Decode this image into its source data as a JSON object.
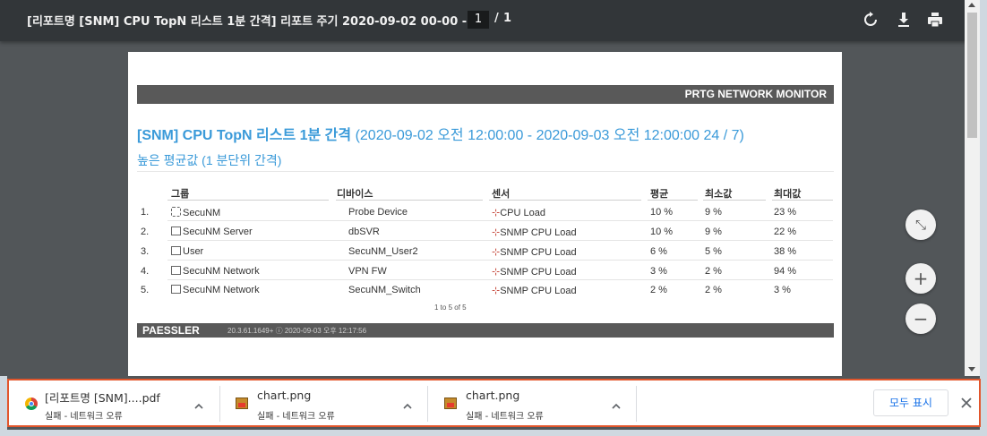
{
  "toolbar": {
    "title": "[리포트명 [SNM] CPU TopN 리스트 1분 간격] 리포트 주기 2020-09-02 00-00 - ...",
    "page_current": "1",
    "page_separator": "/",
    "page_total": "1",
    "icons": [
      "rotate-icon",
      "download-icon",
      "print-icon"
    ]
  },
  "report": {
    "banner": "PRTG NETWORK MONITOR",
    "title_bold": "[SNM] CPU TopN 리스트 1분 간격",
    "title_range": " (2020-09-02 오전 12:00:00 - 2020-09-03 오전 12:00:00 24 / 7)",
    "subtitle": "높은 평균값 (1 분단위 간격)",
    "columns": [
      "그룹",
      "디바이스",
      "센서",
      "평균",
      "최소값",
      "최대값"
    ],
    "rows": [
      {
        "num": "1.",
        "group": "SecuNM",
        "device": "Probe Device",
        "sensor": "CPU Load",
        "avg": "10 %",
        "min": "9 %",
        "max": "23 %"
      },
      {
        "num": "2.",
        "group": "SecuNM Server",
        "device": "dbSVR",
        "sensor": "SNMP CPU Load",
        "avg": "10 %",
        "min": "9 %",
        "max": "22 %"
      },
      {
        "num": "3.",
        "group": "User",
        "device": "SecuNM_User2",
        "sensor": "SNMP CPU Load",
        "avg": "6 %",
        "min": "5 %",
        "max": "38 %"
      },
      {
        "num": "4.",
        "group": "SecuNM Network",
        "device": "VPN FW",
        "sensor": "SNMP CPU Load",
        "avg": "3 %",
        "min": "2 %",
        "max": "94 %"
      },
      {
        "num": "5.",
        "group": "SecuNM Network",
        "device": "SecuNM_Switch",
        "sensor": "SNMP CPU Load",
        "avg": "2 %",
        "min": "2 %",
        "max": "3 %"
      }
    ],
    "paging": "1 to 5 of 5",
    "footer_logo": "PAESSLER",
    "footer_meta": "20.3.61.1649+ ⓘ 2020-09-03 오후 12:17:56"
  },
  "zoom": {
    "fit_symbol": "⤡",
    "plus_symbol": "+",
    "minus_symbol": "−"
  },
  "downloads": {
    "items": [
      {
        "name": "[리포트명 [SNM]....pdf",
        "status": "실패 - 네트워크 오류",
        "icon": "chrome-icon"
      },
      {
        "name": "chart.png",
        "status": "실패 - 네트워크 오류",
        "icon": "image-file-icon"
      },
      {
        "name": "chart.png",
        "status": "실패 - 네트워크 오류",
        "icon": "image-file-icon"
      }
    ],
    "show_all": "모두 표시",
    "close_symbol": "✕"
  },
  "colors": {
    "toolbar": "#323639",
    "background": "#525659",
    "accent_title": "#3a9ad9",
    "shelf_border": "#e2562c",
    "show_all_text": "#1a73e8"
  }
}
